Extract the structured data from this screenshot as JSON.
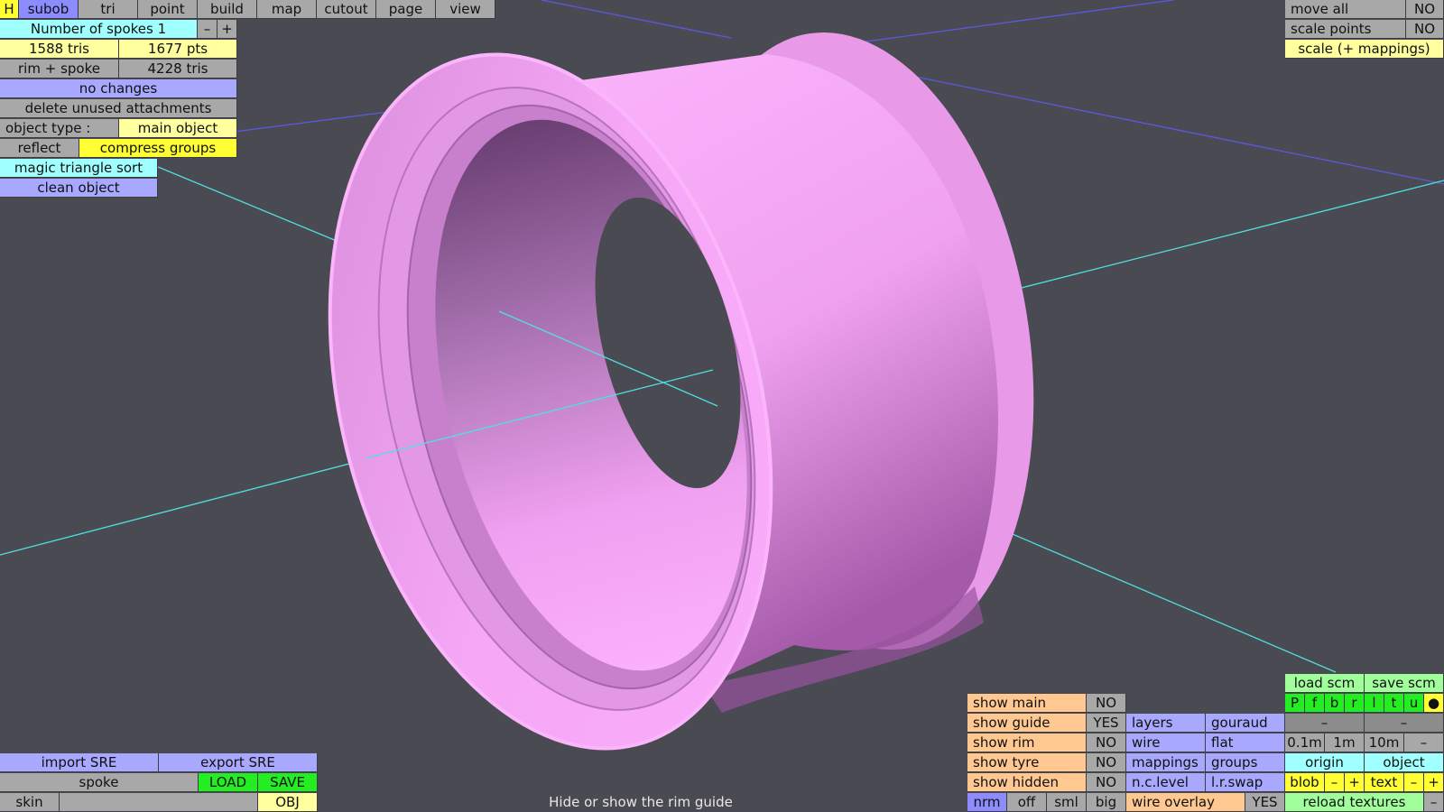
{
  "menu": {
    "h": "H",
    "tabs": [
      "subob",
      "tri",
      "point",
      "build",
      "map",
      "cutout",
      "page",
      "view"
    ]
  },
  "spokes": {
    "label": "Number of spokes 1",
    "minus": "–",
    "plus": "+"
  },
  "stats": {
    "tris": "1588 tris",
    "pts": "1677 pts",
    "rim_spoke": "rim + spoke",
    "total_tris": "4228 tris"
  },
  "changes": "no changes",
  "delete_unused": "delete unused attachments",
  "object_type": {
    "label": "object type :",
    "value": "main object"
  },
  "reflect": "reflect",
  "compress_groups": "compress groups",
  "magic_sort": "magic triangle sort",
  "clean_object": "clean object",
  "top_right": {
    "move_all": "move all",
    "move_all_value": "NO",
    "scale_points": "scale points",
    "scale_points_value": "NO",
    "scale_mappings": "scale (+ mappings)"
  },
  "bottom_left": {
    "import_sre": "import SRE",
    "export_sre": "export SRE",
    "spoke": "spoke",
    "load": "LOAD",
    "save": "SAVE",
    "skin": "skin",
    "obj": "OBJ"
  },
  "status_text": "Hide or show the rim guide",
  "show": [
    {
      "label": "show main",
      "value": "NO"
    },
    {
      "label": "show guide",
      "value": "YES"
    },
    {
      "label": "show rim",
      "value": "NO"
    },
    {
      "label": "show tyre",
      "value": "NO"
    },
    {
      "label": "show hidden",
      "value": "NO"
    }
  ],
  "render_modes": {
    "layers": "layers",
    "gouraud": "gouraud",
    "wire": "wire",
    "flat": "flat",
    "mappings": "mappings",
    "groups": "groups",
    "nc_level": "n.c.level",
    "lr_swap": "l.r.swap",
    "wire_overlay": "wire overlay",
    "wire_overlay_value": "YES"
  },
  "normals": [
    "nrm",
    "off",
    "sml",
    "big"
  ],
  "scm": {
    "load": "load scm",
    "save": "save scm",
    "letters": [
      "P",
      "f",
      "b",
      "r",
      "l",
      "t",
      "u",
      "●"
    ],
    "dash": "–"
  },
  "grid": {
    "a": "0.1m",
    "b": "1m",
    "c": "10m",
    "d": "–"
  },
  "origin": "origin",
  "object": "object",
  "blob": "blob",
  "text": "text",
  "reload_textures": "reload textures",
  "colors": {
    "background": "#4a4a52",
    "rim_pink": "#f7a6f7",
    "guide_blue": "#5a5ae0",
    "guide_cyan": "#50e0e0"
  }
}
